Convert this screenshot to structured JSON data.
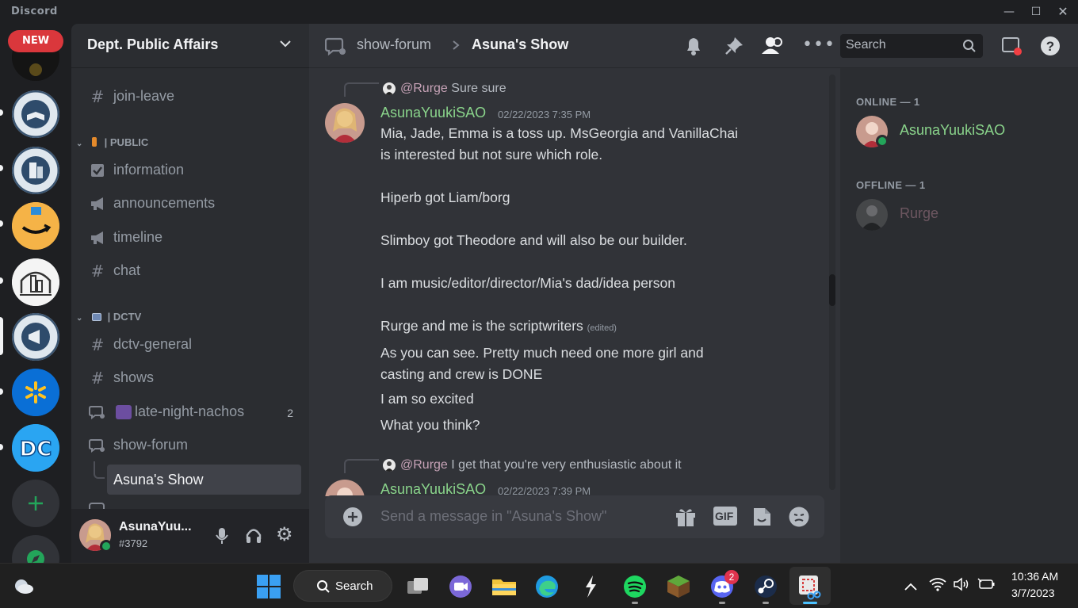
{
  "app": {
    "brand": "Discord",
    "new_badge": "NEW"
  },
  "server": {
    "name": "Dept. Public Affairs"
  },
  "channels": {
    "top": [
      {
        "icon": "hash",
        "label": "join-leave"
      }
    ],
    "categories": [
      {
        "label": "| PUBLIC",
        "items": [
          {
            "icon": "checkbox",
            "label": "information"
          },
          {
            "icon": "megaphone",
            "label": "announcements"
          },
          {
            "icon": "megaphone",
            "label": "timeline"
          },
          {
            "icon": "hash",
            "label": "chat"
          }
        ]
      },
      {
        "label": "| DCTV",
        "items": [
          {
            "icon": "hash-thread",
            "label": "dctv-general"
          },
          {
            "icon": "hash-thread",
            "label": "shows"
          },
          {
            "icon": "forum",
            "label": "late-night-nachos",
            "badge": "2"
          },
          {
            "icon": "forum",
            "label": "show-forum"
          }
        ]
      }
    ],
    "active_thread": "Asuna's Show"
  },
  "user_panel": {
    "name": "AsunaYuu...",
    "tag": "#3792"
  },
  "header": {
    "parent": "show-forum",
    "separator": ">",
    "thread": "Asuna's Show",
    "search_placeholder": "Search"
  },
  "messages": [
    {
      "reply_to": "@Rurge",
      "reply_text": "Sure sure",
      "author": "AsunaYuukiSAO",
      "timestamp": "02/22/2023 7:35 PM",
      "lines": [
        "Mia, Jade, Emma is a toss up. MsGeorgia and VanillaChai",
        "is interested but not sure which role.",
        "",
        "Hiperb got Liam/borg",
        "",
        "Slimboy got Theodore and will also be our builder.",
        "",
        "I am music/editor/director/Mia's dad/idea person",
        "",
        "Rurge and me is the scriptwriters"
      ],
      "edited": "(edited)",
      "followups": [
        "As you can see. Pretty much need one more girl and",
        "casting and crew is DONE",
        "I am so excited",
        "What you think?"
      ]
    },
    {
      "reply_to": "@Rurge",
      "reply_text": "I get that you're very enthusiastic about it",
      "author": "AsunaYuukiSAO",
      "timestamp": "02/22/2023 7:39 PM"
    }
  ],
  "composer": {
    "placeholder": "Send a message in \"Asuna's Show\"",
    "gif": "GIF"
  },
  "members": {
    "online_header": "ONLINE — 1",
    "online": [
      {
        "name": "AsunaYuukiSAO"
      }
    ],
    "offline_header": "OFFLINE — 1",
    "offline": [
      {
        "name": "Rurge"
      }
    ]
  },
  "taskbar": {
    "search_label": "Search",
    "discord_badge": "2",
    "time": "10:36 AM",
    "date": "3/7/2023"
  },
  "colors": {
    "accent_green": "#8ad48b",
    "online": "#23a55a",
    "link": "#b5bac1",
    "new_red": "#da373c"
  }
}
